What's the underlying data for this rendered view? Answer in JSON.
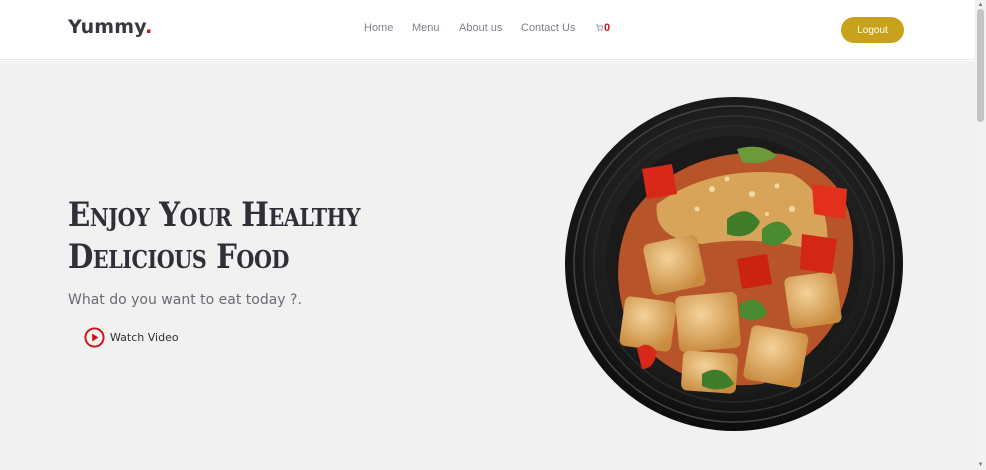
{
  "header": {
    "logo_text": "Yummy",
    "logo_dot": ".",
    "nav": [
      {
        "label": "Home"
      },
      {
        "label": "Menu"
      },
      {
        "label": "About us"
      },
      {
        "label": "Contact Us"
      }
    ],
    "cart_count": "0",
    "cart_icon": "cart-icon",
    "logout_label": "Logout"
  },
  "hero": {
    "title": "Enjoy Your Healthy Delicious Food",
    "subtitle": "What do you want to eat today ?.",
    "watch_label": "Watch Video",
    "watch_icon": "play-circle-icon",
    "image": "food-bowl-image"
  },
  "colors": {
    "accent_red": "#ce1212",
    "logout_gold": "#c8a21a",
    "hero_bg": "#f1f1f1",
    "text_dark": "#2f2f38"
  }
}
